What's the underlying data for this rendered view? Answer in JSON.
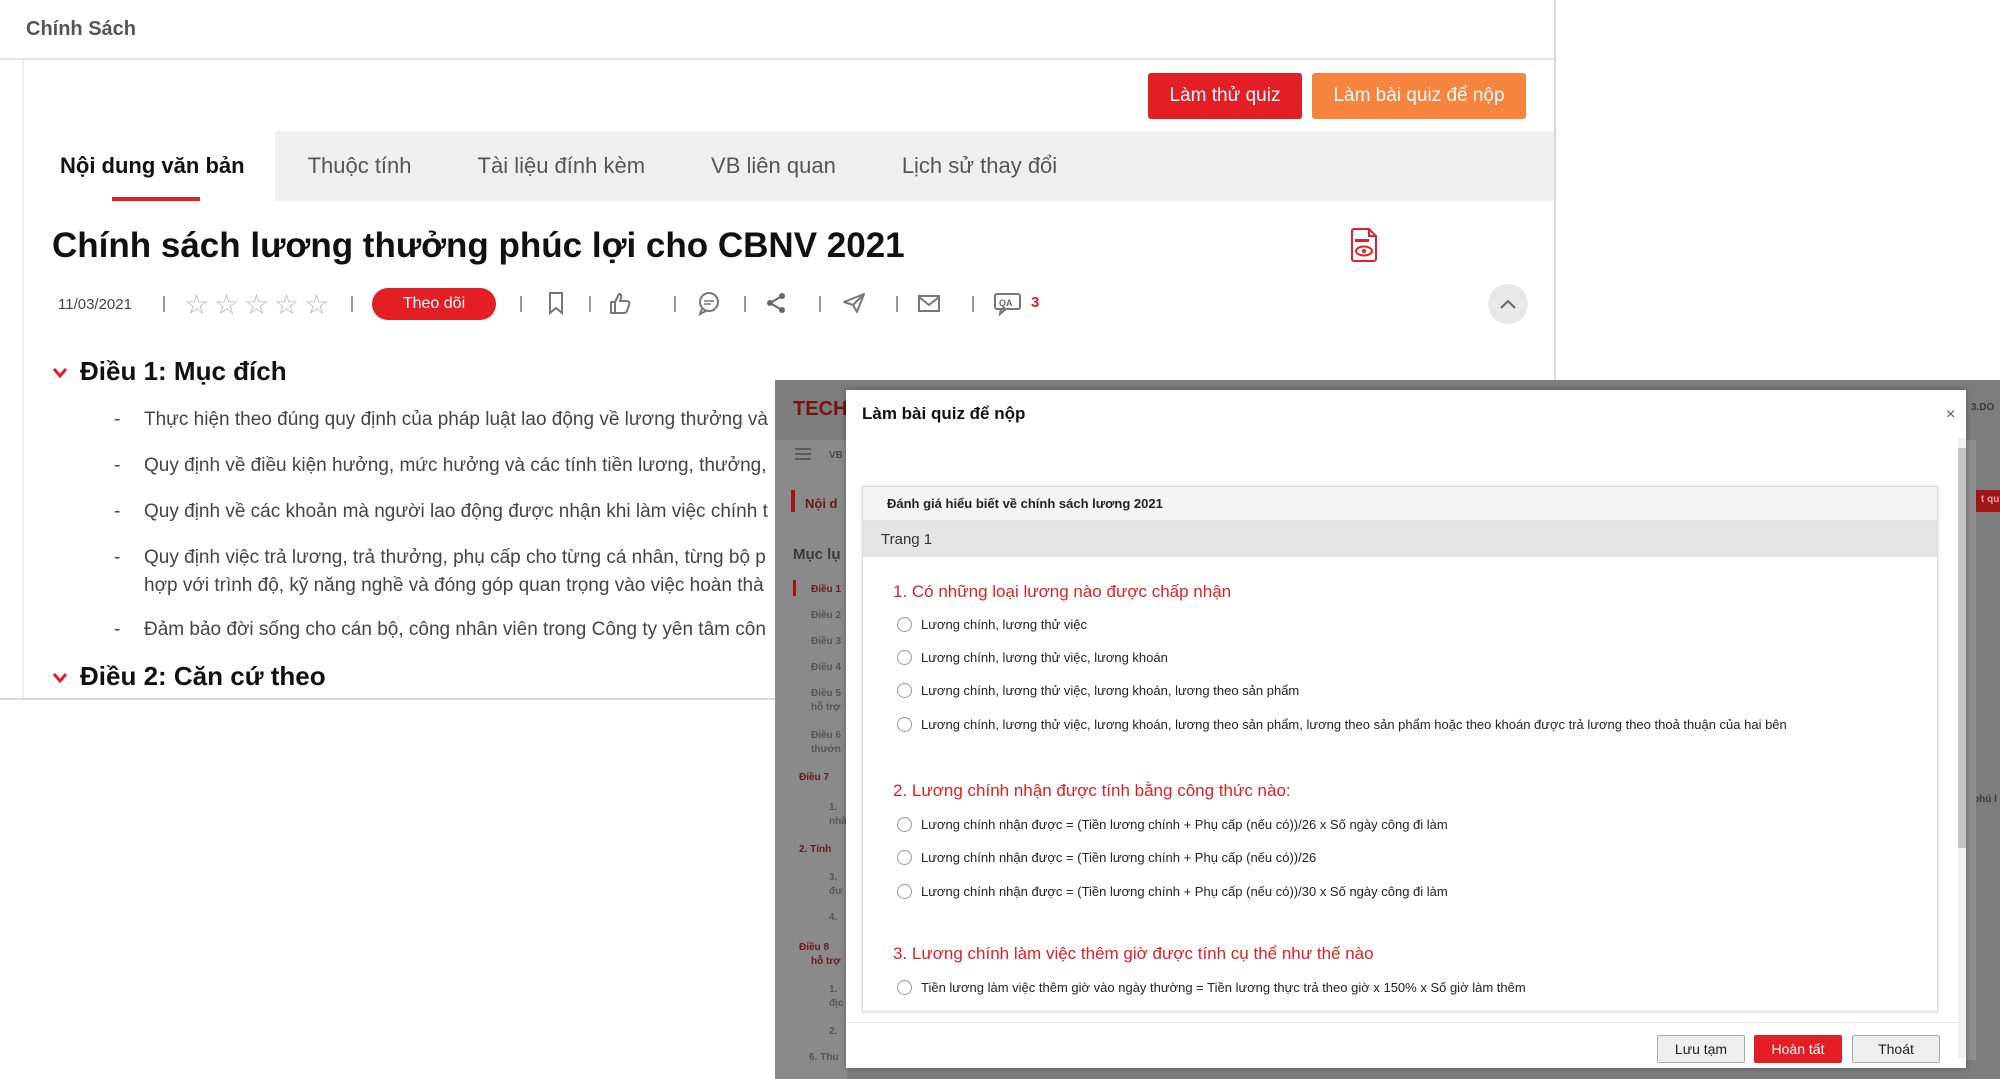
{
  "header": {
    "title": "Chính Sách"
  },
  "actions": {
    "try_quiz": "Làm thử quiz",
    "submit_quiz": "Làm bài quiz để nộp"
  },
  "tabs": [
    {
      "label": "Nội dung văn bản",
      "active": true
    },
    {
      "label": "Thuộc tính"
    },
    {
      "label": "Tài liệu đính kèm"
    },
    {
      "label": "VB liên quan"
    },
    {
      "label": "Lịch sử thay đổi"
    }
  ],
  "document": {
    "title": "Chính sách lương thưởng phúc lợi cho CBNV 2021",
    "date": "11/03/2021",
    "follow_label": "Theo dõi",
    "qa_count": "3",
    "rating_stars": 5
  },
  "sections": [
    {
      "title": "Điều 1: Mục đích",
      "bullets": [
        "Thực hiện theo đúng quy định của pháp luật lao động về lương thưởng và",
        "Quy định về điều kiện hưởng, mức hưởng và các tính tiền lương, thưởng,",
        "Quy định về các khoản mà người lao động được nhận khi làm việc chính t",
        "Quy định việc trả lương, trả thưởng, phụ cấp cho từng cá nhân, từng bộ p",
        "hợp với trình độ, kỹ năng nghề và đóng góp quan trọng vào việc hoàn thà",
        "Đảm bảo đời sống cho cán bộ, công nhân viên trong Công ty yên tâm côn"
      ]
    },
    {
      "title": "Điều 2: Căn cứ theo"
    }
  ],
  "background_app": {
    "logo": "TECH",
    "fragments": {
      "tab": "VB",
      "nav": "Nội d",
      "toc": "Mục lụ",
      "docref": "3.DO",
      "quiz": "t qu",
      "phu": "phú l"
    },
    "toc_items": [
      "Điều 1",
      "Điều 2",
      "Điều 3",
      "Điều 4",
      "Điều 5",
      "hỗ trợ",
      "Điều 6",
      "thưởn",
      "Điều 7",
      "1.",
      "nhâ",
      "2. Tính",
      "3.",
      "đư",
      "4.",
      "Điều 8",
      "hỗ trợ",
      "1.",
      "địc",
      "2.",
      "6. Thu"
    ]
  },
  "modal": {
    "title": "Làm bài quiz để nộp",
    "close": "×",
    "quiz_title": "Đánh giá hiểu biết về chính sách lương 2021",
    "page_label": "Trang 1",
    "questions": [
      {
        "title": "1. Có những loại lương nào được chấp nhận",
        "options": [
          "Lương chính, lương thử việc",
          "Lương chính, lương thử việc, lương khoán",
          "Lương chính, lương thử việc, lương khoán, lương theo sản phẩm",
          "Lương chính, lương thử việc, lương khoán, lương theo sản phẩm, lương theo sản phẩm hoặc theo khoán được trả lương theo thoả thuận của hai bên"
        ]
      },
      {
        "title": "2. Lương chính nhận được tính bằng công thức nào:",
        "options": [
          "Lương chính nhận được = (Tiền lương chính + Phụ cấp (nếu có))/26 x Số ngày công đi làm",
          "Lương chính nhận được = (Tiền lương chính + Phụ cấp (nếu có))/26",
          "Lương chính nhận được = (Tiền lương chính + Phụ cấp (nếu có))/30 x Số ngày công đi làm"
        ]
      },
      {
        "title": "3. Lương chính làm việc thêm giờ được tính cụ thể như thế nào",
        "options": [
          "Tiền lương làm việc thêm giờ vào ngày thường = Tiền lương thực trả theo giờ x 150% x Số giờ làm thêm"
        ]
      }
    ],
    "buttons": {
      "save": "Lưu tạm",
      "finish": "Hoàn tất",
      "exit": "Thoát"
    }
  }
}
